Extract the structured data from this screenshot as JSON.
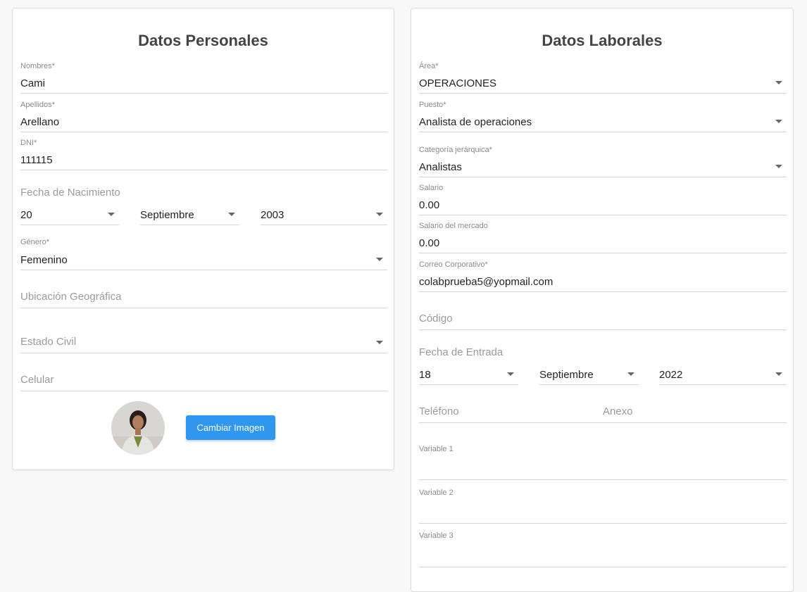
{
  "personal": {
    "title": "Datos Personales",
    "nombres": {
      "label": "Nombres*",
      "value": "Cami"
    },
    "apellidos": {
      "label": "Apellidos*",
      "value": "Arellano"
    },
    "dni": {
      "label": "DNI*",
      "value": "111115"
    },
    "fecha_nacimiento": {
      "label": "Fecha de Nacimiento",
      "day": "20",
      "month": "Septiembre",
      "year": "2003"
    },
    "genero": {
      "label": "Género*",
      "value": "Femenino"
    },
    "ubicacion": {
      "placeholder": "Ubicación Geográfica"
    },
    "estado_civil": {
      "placeholder": "Estado Civil"
    },
    "celular": {
      "placeholder": "Celular"
    },
    "change_image_label": "Cambiar Imagen"
  },
  "laboral": {
    "title": "Datos Laborales",
    "area": {
      "label": "Área*",
      "value": "OPERACIONES"
    },
    "puesto": {
      "label": "Puesto*",
      "value": "Analista de operaciones"
    },
    "categoria": {
      "label": "Categoría jerárquica*",
      "value": "Analistas"
    },
    "salario": {
      "label": "Salario",
      "value": "0.00"
    },
    "salario_mercado": {
      "label": "Salario del mercado",
      "value": "0.00"
    },
    "correo": {
      "label": "Correo Corporativo*",
      "value": "colabprueba5@yopmail.com"
    },
    "codigo": {
      "placeholder": "Código"
    },
    "fecha_entrada": {
      "label": "Fecha de Entrada",
      "day": "18",
      "month": "Septiembre",
      "year": "2022"
    },
    "telefono": {
      "placeholder": "Teléfono"
    },
    "anexo": {
      "placeholder": "Anexo"
    },
    "variable1": {
      "label": "Variable 1"
    },
    "variable2": {
      "label": "Variable 2"
    },
    "variable3": {
      "label": "Variable 3"
    }
  },
  "colors": {
    "primary_button": "#2f97f0",
    "page_bg": "#f8f8f8",
    "card_border": "#dcdcdc"
  }
}
